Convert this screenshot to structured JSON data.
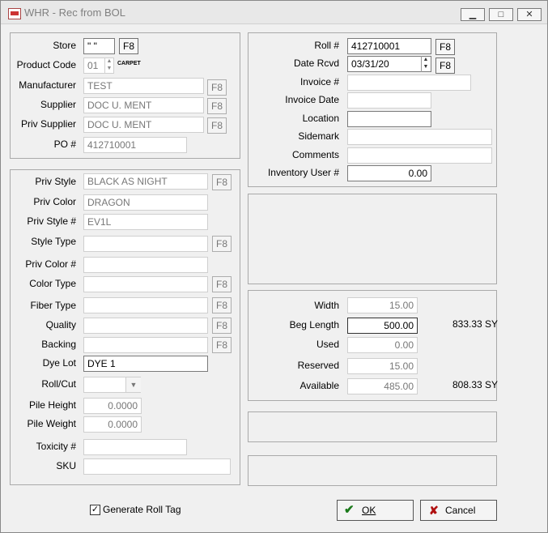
{
  "window": {
    "title": "WHR - Rec from BOL",
    "minimize_glyph": "▁",
    "maximize_glyph": "□",
    "close_glyph": "✕"
  },
  "header": {
    "store_label": "Store",
    "store_value": "\" \"",
    "product_code_label": "Product Code",
    "product_code_value": "01",
    "product_code_desc": "CARPET",
    "manufacturer_label": "Manufacturer",
    "manufacturer_value": "TEST",
    "supplier_label": "Supplier",
    "supplier_value": "DOC U. MENT",
    "priv_supplier_label": "Priv Supplier",
    "priv_supplier_value": "DOC U. MENT",
    "po_label": "PO #",
    "po_value": "412710001"
  },
  "style": {
    "priv_style_label": "Priv Style",
    "priv_style_value": "BLACK AS NIGHT",
    "priv_color_label": "Priv Color",
    "priv_color_value": "DRAGON",
    "priv_style_num_label": "Priv Style #",
    "priv_style_num_value": "EV1L",
    "style_type_label": "Style Type",
    "style_type_value": "",
    "priv_color_num_label": "Priv Color #",
    "priv_color_num_value": "",
    "color_type_label": "Color Type",
    "color_type_value": "",
    "fiber_type_label": "Fiber Type",
    "fiber_type_value": "",
    "quality_label": "Quality",
    "quality_value": "",
    "backing_label": "Backing",
    "backing_value": "",
    "dye_lot_label": "Dye Lot",
    "dye_lot_value": "DYE 1",
    "roll_cut_label": "Roll/Cut",
    "roll_cut_value": "",
    "pile_height_label": "Pile Height",
    "pile_height_value": "0.0000",
    "pile_weight_label": "Pile Weight",
    "pile_weight_value": "0.0000",
    "toxicity_label": "Toxicity #",
    "toxicity_value": "",
    "sku_label": "SKU",
    "sku_value": ""
  },
  "roll": {
    "roll_num_label": "Roll #",
    "roll_num_value": "412710001",
    "date_rcvd_label": "Date Rcvd",
    "date_rcvd_value": "03/31/20",
    "invoice_num_label": "Invoice #",
    "invoice_num_value": "",
    "invoice_date_label": "Invoice Date",
    "invoice_date_value": "",
    "location_label": "Location",
    "location_value": "",
    "sidemark_label": "Sidemark",
    "sidemark_value": "",
    "comments_label": "Comments",
    "comments_value": "",
    "inventory_user_label": "Inventory User #",
    "inventory_user_value": "0.00"
  },
  "quantities": {
    "width_label": "Width",
    "width_value": "15.00",
    "beg_length_label": "Beg Length",
    "beg_length_value": "500.00",
    "beg_length_sy": "833.33 SY",
    "used_label": "Used",
    "used_value": "0.00",
    "reserved_label": "Reserved",
    "reserved_value": "15.00",
    "available_label": "Available",
    "available_value": "485.00",
    "available_sy": "808.33 SY"
  },
  "footer": {
    "generate_roll_tag_label": "Generate Roll Tag",
    "generate_roll_tag_checked": true,
    "ok_label": "OK",
    "cancel_label": "Cancel"
  },
  "f8_label": "F8",
  "icons": {
    "ok": "check-icon",
    "cancel": "x-icon",
    "spin": "spin-arrows-icon",
    "dropdown": "chevron-down-icon"
  }
}
